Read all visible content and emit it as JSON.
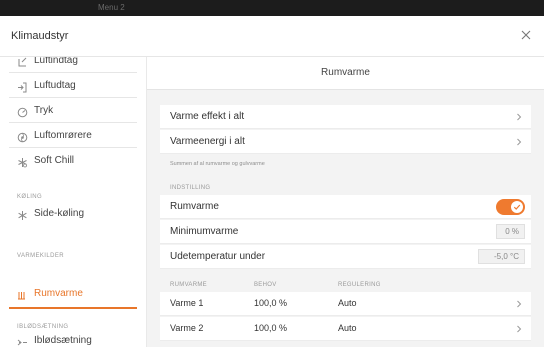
{
  "background_window": {
    "title": "Menu 2"
  },
  "dialog": {
    "title": "Klimaudstyr",
    "close_icon": "close-icon"
  },
  "sidebar": {
    "items_top": [
      {
        "label": "Luftindtag",
        "icon": "air-intake-icon"
      },
      {
        "label": "Luftudtag",
        "icon": "air-outlet-icon"
      },
      {
        "label": "Tryk",
        "icon": "pressure-icon"
      },
      {
        "label": "Luftomrørere",
        "icon": "fan-icon"
      },
      {
        "label": "Soft Chill",
        "icon": "soft-chill-icon"
      }
    ],
    "section_cooling": {
      "heading": "KØLING",
      "items": [
        {
          "label": "Side-køling",
          "icon": "snowflake-icon"
        }
      ]
    },
    "section_heat": {
      "heading": "VARMEKILDER",
      "items": [
        {
          "label": "Rumvarme",
          "icon": "heater-icon",
          "active": true
        }
      ]
    },
    "section_soak": {
      "heading": "IBLØDSÆTNING",
      "items": [
        {
          "label": "Iblødsætning",
          "icon": "spray-icon"
        }
      ]
    }
  },
  "panel": {
    "title": "Rumvarme",
    "summary_rows": [
      {
        "label": "Varme effekt i alt"
      },
      {
        "label": "Varmeenergi i alt"
      }
    ],
    "summary_note": "Summen af al rumvarme og gulvvarme",
    "settings": {
      "heading": "INDSTILLING",
      "rows": [
        {
          "label": "Rumvarme",
          "toggle": true
        },
        {
          "label": "Minimumvarme",
          "value": "0 %"
        },
        {
          "label": "Udetemperatur under",
          "value": "-5,0 °C"
        }
      ]
    },
    "table": {
      "columns": [
        "RUMVARME",
        "BEHOV",
        "REGULERING"
      ],
      "rows": [
        {
          "name": "Varme 1",
          "demand": "100,0 %",
          "regulation": "Auto"
        },
        {
          "name": "Varme 2",
          "demand": "100,0 %",
          "regulation": "Auto"
        }
      ]
    }
  },
  "colors": {
    "accent": "#e8762a",
    "toggle_on": "#ef7a2f"
  }
}
